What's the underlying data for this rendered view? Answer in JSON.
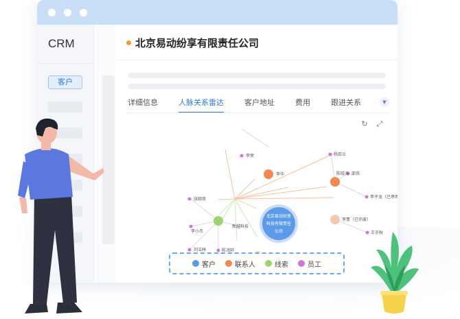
{
  "window": {
    "app_title": "CRM",
    "sidebar_active": "客户"
  },
  "company": {
    "name": "北京易动纷享有限责任公司"
  },
  "tabs": [
    {
      "label": "详细信息"
    },
    {
      "label": "人脉关系雷达",
      "active": true
    },
    {
      "label": "客户地址"
    },
    {
      "label": "费用"
    },
    {
      "label": "跟进关系"
    }
  ],
  "graph": {
    "center": {
      "line1": "北京易动纷享",
      "line2": "科技有限责任",
      "line3": "公司"
    },
    "nodes": {
      "li_rong": "李荣",
      "li_hua": "李华",
      "yang_ruolan": "杨若兰",
      "chen_xiaohai": "陈晓海",
      "zhou_wei": "邵伟",
      "li_zilong": "李子龙（已停用）",
      "zhang_wanqi": "张婉奇",
      "li_xiaojie": "李小杰",
      "liu_jielin": "刘洁林",
      "chen_hongxuan": "陈鸿轩",
      "xinda_tech": "新越科技",
      "li_qing": "李青（已作废）",
      "wang_yiqiu": "王亦秋"
    }
  },
  "legend": [
    {
      "label": "客户",
      "color": "#5b9bea"
    },
    {
      "label": "联系人",
      "color": "#f08a50"
    },
    {
      "label": "线索",
      "color": "#9fd36b"
    },
    {
      "label": "员工",
      "color": "#d078d8"
    }
  ],
  "colors": {
    "customer": "#5b9bea",
    "contact": "#f08a50",
    "lead": "#9fd36b",
    "employee": "#d078d8",
    "accent": "#2e7ad6"
  },
  "icons": {
    "refresh": "refresh-icon",
    "fullscreen": "fullscreen-icon",
    "more": "chevron-down-icon"
  }
}
